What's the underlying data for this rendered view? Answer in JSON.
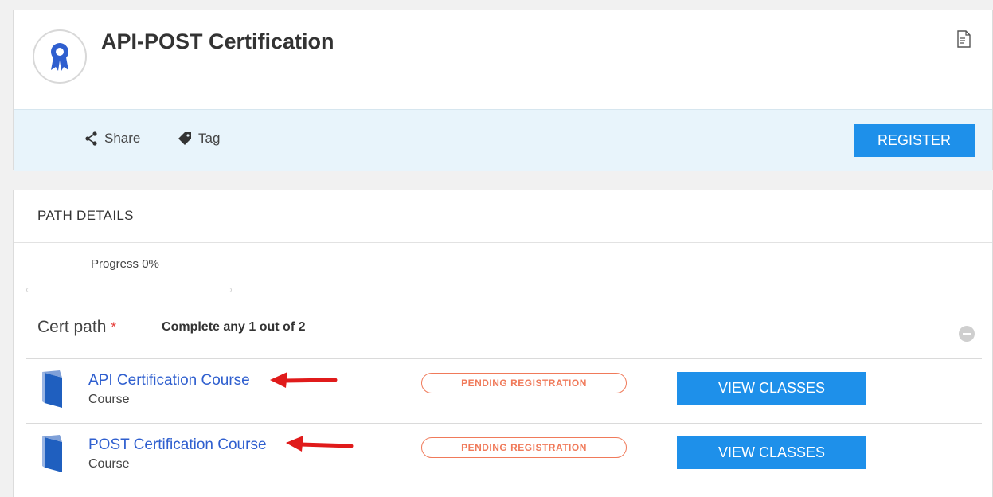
{
  "header": {
    "title": "API-POST Certification",
    "badge_icon": "award-ribbon-icon",
    "doc_icon": "document-icon"
  },
  "actions": {
    "share_label": "Share",
    "tag_label": "Tag",
    "register_label": "REGISTER"
  },
  "path": {
    "section_title": "PATH DETAILS",
    "progress_label": "Progress 0%",
    "progress_value": 0,
    "cert_title": "Cert path",
    "required_mark": "*",
    "requirement": "Complete any 1 out of 2",
    "courses": [
      {
        "name": "API Certification Course",
        "type": "Course",
        "status": "PENDING REGISTRATION",
        "button": "VIEW CLASSES"
      },
      {
        "name": "POST Certification Course",
        "type": "Course",
        "status": "PENDING REGISTRATION",
        "button": "VIEW CLASSES"
      }
    ]
  },
  "colors": {
    "accent": "#1e90ea",
    "pending": "#f07a5a",
    "link": "#2f5fcf",
    "annotation_arrow": "#e01b1b"
  }
}
